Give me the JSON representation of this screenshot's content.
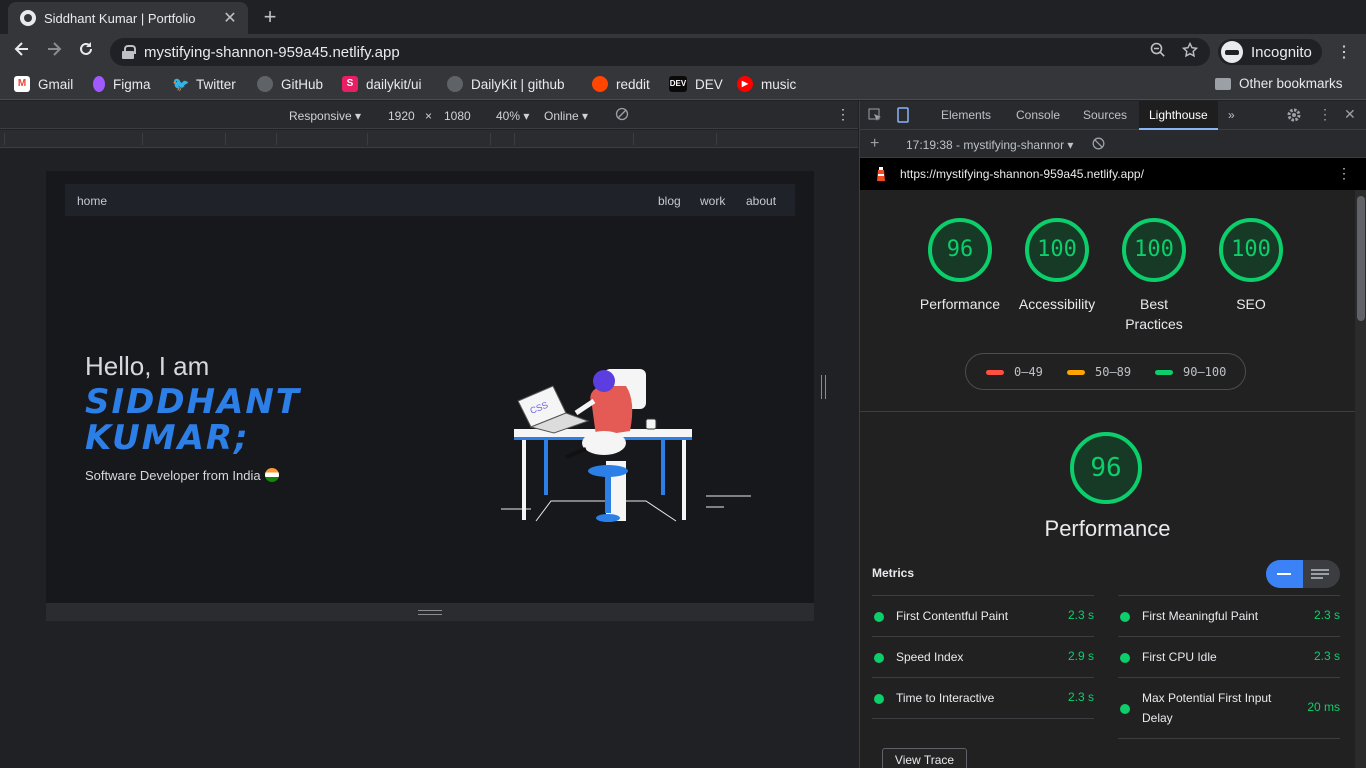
{
  "browser": {
    "tab_title": "Siddhant Kumar | Portfolio",
    "tab_close": "✕",
    "new_tab": "+",
    "url": "mystifying-shannon-959a45.netlify.app",
    "profile_label": "Incognito"
  },
  "bookmarks": [
    {
      "label": "Gmail",
      "icon": "gmail-icon",
      "color": "#ea4335"
    },
    {
      "label": "Figma",
      "icon": "figma-icon",
      "color": "#a259ff"
    },
    {
      "label": "Twitter",
      "icon": "twitter-icon",
      "color": "#1da1f2"
    },
    {
      "label": "GitHub",
      "icon": "github-icon",
      "color": "#5f6368"
    },
    {
      "label": "dailykit/ui",
      "icon": "dailykit-icon",
      "color": "#e91e63"
    },
    {
      "label": "DailyKit | github",
      "icon": "github-icon",
      "color": "#5f6368"
    },
    {
      "label": "reddit",
      "icon": "reddit-icon",
      "color": "#ff4500"
    },
    {
      "label": "DEV",
      "icon": "dev-icon",
      "color": "#0a0a0a"
    },
    {
      "label": "music",
      "icon": "youtube-music-icon",
      "color": "#ff0000"
    }
  ],
  "other_bookmarks": "Other bookmarks",
  "device_toolbar": {
    "mode": "Responsive",
    "width": "1920",
    "times": "×",
    "height": "1080",
    "zoom": "40%",
    "network": "Online"
  },
  "site": {
    "nav_home": "home",
    "nav_blog": "blog",
    "nav_work": "work",
    "nav_about": "about",
    "hello": "Hello, I am",
    "name_line1": "SIDDHANT",
    "name_line2": "KUMAR;",
    "subtitle": "Software Developer from India",
    "laptop_text": "CSS"
  },
  "devtools": {
    "tabs": [
      "Elements",
      "Console",
      "Sources",
      "Lighthouse"
    ],
    "active_tab": "Lighthouse",
    "more_tabs": "»",
    "report_select": "17:19:38 - mystifying-shannor",
    "report_url": "https://mystifying-shannon-959a45.netlify.app/",
    "scores": [
      {
        "value": "96",
        "label": "Performance"
      },
      {
        "value": "100",
        "label": "Accessibility"
      },
      {
        "value": "100",
        "label": "Best Practices"
      },
      {
        "value": "100",
        "label": "SEO"
      }
    ],
    "legend": [
      {
        "range": "0–49",
        "color": "#ff4e42"
      },
      {
        "range": "50–89",
        "color": "#ffa400"
      },
      {
        "range": "90–100",
        "color": "#0cce6b"
      }
    ],
    "performance_score": "96",
    "performance_title": "Performance",
    "metrics_header": "Metrics",
    "metrics_left": [
      {
        "name": "First Contentful Paint",
        "value": "2.3 s"
      },
      {
        "name": "Speed Index",
        "value": "2.9 s"
      },
      {
        "name": "Time to Interactive",
        "value": "2.3 s"
      }
    ],
    "metrics_right": [
      {
        "name": "First Meaningful Paint",
        "value": "2.3 s"
      },
      {
        "name": "First CPU Idle",
        "value": "2.3 s"
      },
      {
        "name": "Max Potential First Input Delay",
        "value": "20 ms"
      }
    ],
    "view_trace": "View Trace",
    "pass_color": "#0cce6b"
  }
}
